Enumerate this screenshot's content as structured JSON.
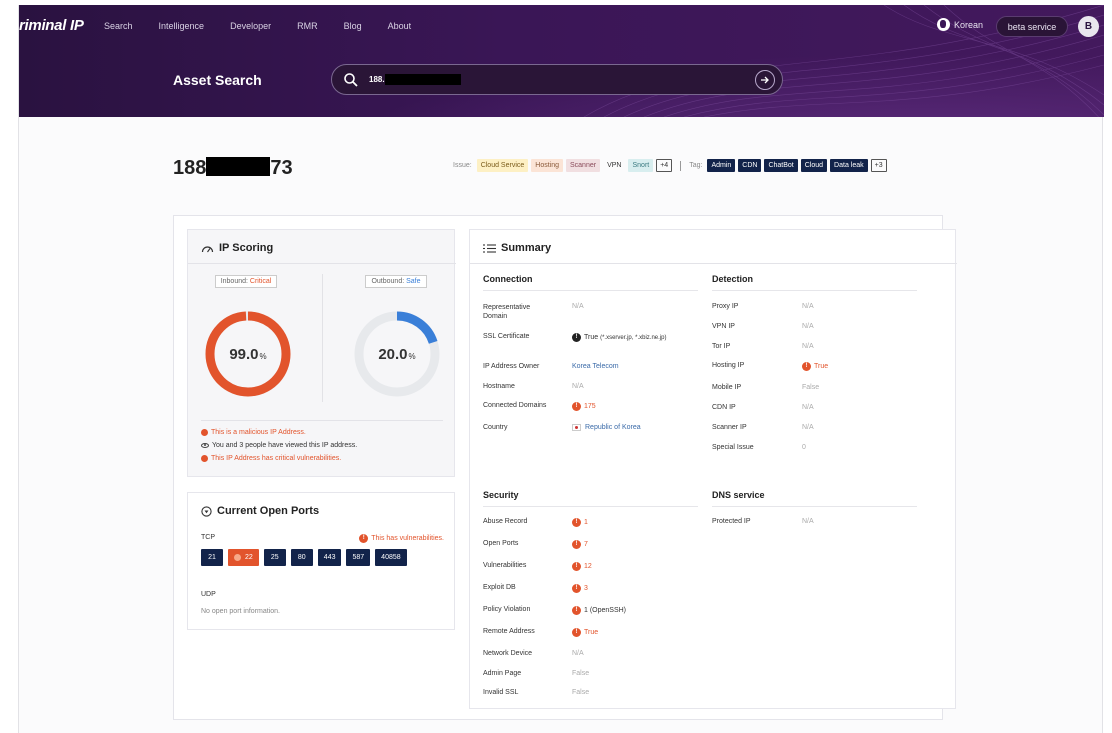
{
  "header": {
    "logo": "riminal IP",
    "nav": [
      "Search",
      "Intelligence",
      "Developer",
      "RMR",
      "Blog",
      "About"
    ],
    "language": "Korean",
    "beta_label": "beta service",
    "avatar_letter": "B",
    "page_heading": "Asset Search",
    "search_value": "188."
  },
  "ip": {
    "prefix": "188",
    "suffix": "73",
    "issue_label": "Issue:",
    "issues": [
      "Cloud Service",
      "Hosting",
      "Scanner",
      "VPN",
      "Snort",
      "+4"
    ],
    "tag_label": "Tag:",
    "tags": [
      "Admin",
      "CDN",
      "ChatBot",
      "Cloud",
      "Data leak",
      "+3"
    ]
  },
  "scoring": {
    "title": "IP Scoring",
    "inbound_label": "Inbound:",
    "inbound_status": "Critical",
    "inbound_score": 99.0,
    "inbound_score_text": "99.0",
    "outbound_label": "Outbound:",
    "outbound_status": "Safe",
    "outbound_score": 20.0,
    "outbound_score_text": "20.0",
    "percent_sign": "%",
    "notes": [
      "This is a malicious IP Address.",
      "You and 3 people have viewed this IP address.",
      "This IP Address has critical vulnerabilities."
    ]
  },
  "ports": {
    "title": "Current Open Ports",
    "tcp_label": "TCP",
    "warning": "This has vulnerabilities.",
    "tcp": [
      "21",
      "22",
      "25",
      "80",
      "443",
      "587",
      "40858"
    ],
    "udp_label": "UDP",
    "udp_empty": "No open port information."
  },
  "summary": {
    "title": "Summary",
    "connection": {
      "heading": "Connection",
      "rows": [
        {
          "k": "Representative Domain",
          "v": "N/A"
        },
        {
          "k": "SSL Certificate",
          "v": "True",
          "extra": "(*.xserver.jp, *.xbiz.ne.jp)"
        },
        {
          "k": "IP Address Owner",
          "v": "Korea Telecom"
        },
        {
          "k": "Hostname",
          "v": "N/A"
        },
        {
          "k": "Connected Domains",
          "v": "175"
        },
        {
          "k": "Country",
          "v": "Republic of Korea"
        }
      ]
    },
    "detection": {
      "heading": "Detection",
      "rows": [
        {
          "k": "Proxy IP",
          "v": "N/A"
        },
        {
          "k": "VPN IP",
          "v": "N/A"
        },
        {
          "k": "Tor IP",
          "v": "N/A"
        },
        {
          "k": "Hosting IP",
          "v": "True"
        },
        {
          "k": "Mobile IP",
          "v": "False"
        },
        {
          "k": "CDN IP",
          "v": "N/A"
        },
        {
          "k": "Scanner IP",
          "v": "N/A"
        },
        {
          "k": "Special Issue",
          "v": "0"
        }
      ]
    },
    "security": {
      "heading": "Security",
      "rows": [
        {
          "k": "Abuse Record",
          "v": "1"
        },
        {
          "k": "Open Ports",
          "v": "7"
        },
        {
          "k": "Vulnerabilities",
          "v": "12"
        },
        {
          "k": "Exploit DB",
          "v": "3"
        },
        {
          "k": "Policy Violation",
          "v": "1 (OpenSSH)"
        },
        {
          "k": "Remote Address",
          "v": "True"
        },
        {
          "k": "Network Device",
          "v": "N/A"
        },
        {
          "k": "Admin Page",
          "v": "False"
        },
        {
          "k": "Invalid SSL",
          "v": "False"
        }
      ]
    },
    "dns": {
      "heading": "DNS service",
      "rows": [
        {
          "k": "Protected IP",
          "v": "N/A"
        }
      ]
    }
  },
  "colors": {
    "critical": "#e2542c",
    "safe": "#3a7fd8",
    "navy": "#12234a",
    "header": "#3a1656"
  }
}
